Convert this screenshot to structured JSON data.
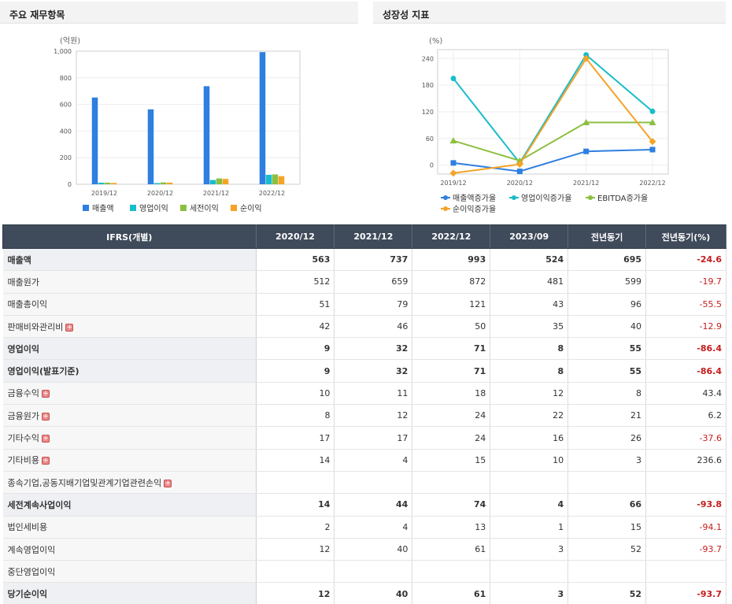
{
  "left_panel": {
    "title": "주요 재무항목"
  },
  "right_panel": {
    "title": "성장성 지표"
  },
  "chart_data": [
    {
      "type": "bar",
      "ylabel": "(억원)",
      "ylim": [
        0,
        1000
      ],
      "yticks": [
        "0",
        "200",
        "400",
        "600",
        "800",
        "1,000"
      ],
      "categories": [
        "2019/12",
        "2020/12",
        "2021/12",
        "2022/12"
      ],
      "series": [
        {
          "name": "매출액",
          "color": "#2e7fe0",
          "values": [
            652,
            563,
            737,
            993
          ]
        },
        {
          "name": "영업이익",
          "color": "#19bccb",
          "values": [
            12,
            9,
            32,
            71
          ]
        },
        {
          "name": "세전이익",
          "color": "#8cbf3f",
          "values": [
            12,
            14,
            44,
            74
          ]
        },
        {
          "name": "순이익",
          "color": "#f5a327",
          "values": [
            10,
            12,
            40,
            61
          ]
        }
      ]
    },
    {
      "type": "line",
      "ylabel": "(%)",
      "ylim": [
        -20,
        260
      ],
      "yticks": [
        "0",
        "60",
        "120",
        "180",
        "240"
      ],
      "categories": [
        "2019/12",
        "2020/12",
        "2021/12",
        "2022/12"
      ],
      "series": [
        {
          "name": "매출액증가율",
          "color": "#2e7fe0",
          "marker": "square",
          "values": [
            5,
            -14,
            31,
            35
          ]
        },
        {
          "name": "영업이익증가율",
          "color": "#19bccb",
          "marker": "circle",
          "values": [
            195,
            5,
            248,
            121
          ]
        },
        {
          "name": "EBITDA증가율",
          "color": "#8cbf3f",
          "marker": "triangle",
          "values": [
            55,
            10,
            96,
            96
          ]
        },
        {
          "name": "순이익증가율",
          "color": "#f5a327",
          "marker": "diamond",
          "values": [
            -18,
            2,
            240,
            53
          ]
        }
      ]
    }
  ],
  "table": {
    "headers": [
      "IFRS(개별)",
      "2020/12",
      "2021/12",
      "2022/12",
      "2023/09",
      "전년동기",
      "전년동기(%)"
    ],
    "rows": [
      {
        "label": "매출액",
        "bold": true,
        "plus": false,
        "values": [
          "563",
          "737",
          "993",
          "524",
          "695",
          "-24.6"
        ]
      },
      {
        "label": "매출원가",
        "bold": false,
        "plus": false,
        "values": [
          "512",
          "659",
          "872",
          "481",
          "599",
          "-19.7"
        ]
      },
      {
        "label": "매출총이익",
        "bold": false,
        "plus": false,
        "values": [
          "51",
          "79",
          "121",
          "43",
          "96",
          "-55.5"
        ]
      },
      {
        "label": "판매비와관리비",
        "bold": false,
        "plus": true,
        "values": [
          "42",
          "46",
          "50",
          "35",
          "40",
          "-12.9"
        ]
      },
      {
        "label": "영업이익",
        "bold": true,
        "plus": false,
        "values": [
          "9",
          "32",
          "71",
          "8",
          "55",
          "-86.4"
        ]
      },
      {
        "label": "영업이익(발표기준)",
        "bold": true,
        "plus": false,
        "values": [
          "9",
          "32",
          "71",
          "8",
          "55",
          "-86.4"
        ]
      },
      {
        "label": "금융수익",
        "bold": false,
        "plus": true,
        "values": [
          "10",
          "11",
          "18",
          "12",
          "8",
          "43.4"
        ]
      },
      {
        "label": "금융원가",
        "bold": false,
        "plus": true,
        "values": [
          "8",
          "12",
          "24",
          "22",
          "21",
          "6.2"
        ]
      },
      {
        "label": "기타수익",
        "bold": false,
        "plus": true,
        "values": [
          "17",
          "17",
          "24",
          "16",
          "26",
          "-37.6"
        ]
      },
      {
        "label": "기타비용",
        "bold": false,
        "plus": true,
        "values": [
          "14",
          "4",
          "15",
          "10",
          "3",
          "236.6"
        ]
      },
      {
        "label": "종속기업,공동지배기업및관계기업관련손익",
        "bold": false,
        "plus": true,
        "values": [
          "",
          "",
          "",
          "",
          "",
          ""
        ]
      },
      {
        "label": "세전계속사업이익",
        "bold": true,
        "plus": false,
        "values": [
          "14",
          "44",
          "74",
          "4",
          "66",
          "-93.8"
        ]
      },
      {
        "label": "법인세비용",
        "bold": false,
        "plus": false,
        "values": [
          "2",
          "4",
          "13",
          "1",
          "15",
          "-94.1"
        ]
      },
      {
        "label": "계속영업이익",
        "bold": false,
        "plus": false,
        "values": [
          "12",
          "40",
          "61",
          "3",
          "52",
          "-93.7"
        ]
      },
      {
        "label": "중단영업이익",
        "bold": false,
        "plus": false,
        "values": [
          "",
          "",
          "",
          "",
          "",
          ""
        ]
      },
      {
        "label": "당기순이익",
        "bold": true,
        "plus": false,
        "values": [
          "12",
          "40",
          "61",
          "3",
          "52",
          "-93.7"
        ]
      }
    ]
  }
}
